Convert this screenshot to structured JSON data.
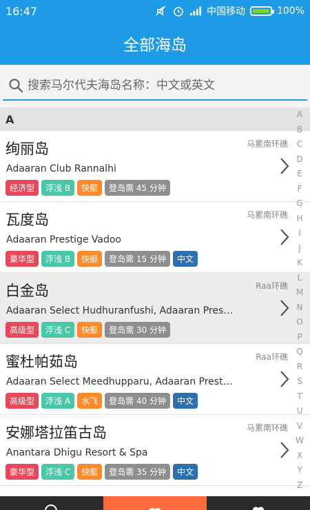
{
  "status_bar": {
    "time": "16:47",
    "carrier": "中国移动",
    "battery": "100%"
  },
  "navbar": {
    "title": "全部海岛"
  },
  "search": {
    "placeholder": "搜索马尔代夫海岛名称：中文或英文",
    "value": ""
  },
  "section": {
    "letter": "A"
  },
  "islands": [
    {
      "name_cn": "绚丽岛",
      "atoll": "马累南环礁",
      "name_en": "Adaaran Club Rannalhi",
      "tags": [
        {
          "label": "经济型",
          "color": "#e9485b"
        },
        {
          "label": "浮浅 B",
          "color": "#49c8a8"
        },
        {
          "label": "快艇",
          "color": "#ff8a2a"
        },
        {
          "label": "登岛需 45 分钟",
          "color": "#8e8e8e"
        }
      ]
    },
    {
      "name_cn": "瓦度岛",
      "atoll": "马累南环礁",
      "name_en": "Adaaran Prestige Vadoo",
      "tags": [
        {
          "label": "豪华型",
          "color": "#e9485b"
        },
        {
          "label": "浮浅 B",
          "color": "#49c8a8"
        },
        {
          "label": "快艇",
          "color": "#ff8a2a"
        },
        {
          "label": "登岛需 15 分钟",
          "color": "#8e8e8e"
        },
        {
          "label": "中文",
          "color": "#2e6fb0"
        }
      ]
    },
    {
      "name_cn": "白金岛",
      "atoll": "Raa环礁",
      "name_en": "Adaaran Select Hudhuranfushi, Adaaran Prestige",
      "tags": [
        {
          "label": "高级型",
          "color": "#e9485b"
        },
        {
          "label": "浮浅 C",
          "color": "#49c8a8"
        },
        {
          "label": "快艇",
          "color": "#ff8a2a"
        },
        {
          "label": "登岛需 30 分钟",
          "color": "#8e8e8e"
        }
      ]
    },
    {
      "name_cn": "蜜杜帕茹岛",
      "atoll": "Raa环礁",
      "name_en": "Adaaran Select Meedhupparu, Adaaran Prestige",
      "tags": [
        {
          "label": "高级型",
          "color": "#e9485b"
        },
        {
          "label": "浮浅 A",
          "color": "#49c8a8"
        },
        {
          "label": "水飞",
          "color": "#ff8a2a"
        },
        {
          "label": "登岛需 40 分钟",
          "color": "#8e8e8e"
        },
        {
          "label": "中文",
          "color": "#2e6fb0"
        }
      ]
    },
    {
      "name_cn": "安娜塔拉笛古岛",
      "atoll": "马累南环礁",
      "name_en": "Anantara Dhigu Resort & Spa",
      "tags": [
        {
          "label": "豪华型",
          "color": "#e9485b"
        },
        {
          "label": "浮浅 C",
          "color": "#49c8a8"
        },
        {
          "label": "快艇",
          "color": "#ff8a2a"
        },
        {
          "label": "登岛需 35 分钟",
          "color": "#8e8e8e"
        },
        {
          "label": "中文",
          "color": "#2e6fb0"
        }
      ]
    }
  ],
  "alpha_index": [
    "A",
    "B",
    "C",
    "D",
    "E",
    "F",
    "G",
    "H",
    "I",
    "J",
    "K",
    "L",
    "M",
    "N",
    "O",
    "P",
    "Q",
    "R",
    "S",
    "T",
    "U",
    "V",
    "W",
    "X",
    "Y",
    "Z"
  ],
  "colors": {
    "primary": "#1e9be6",
    "active_tab": "#ff6a3d"
  }
}
